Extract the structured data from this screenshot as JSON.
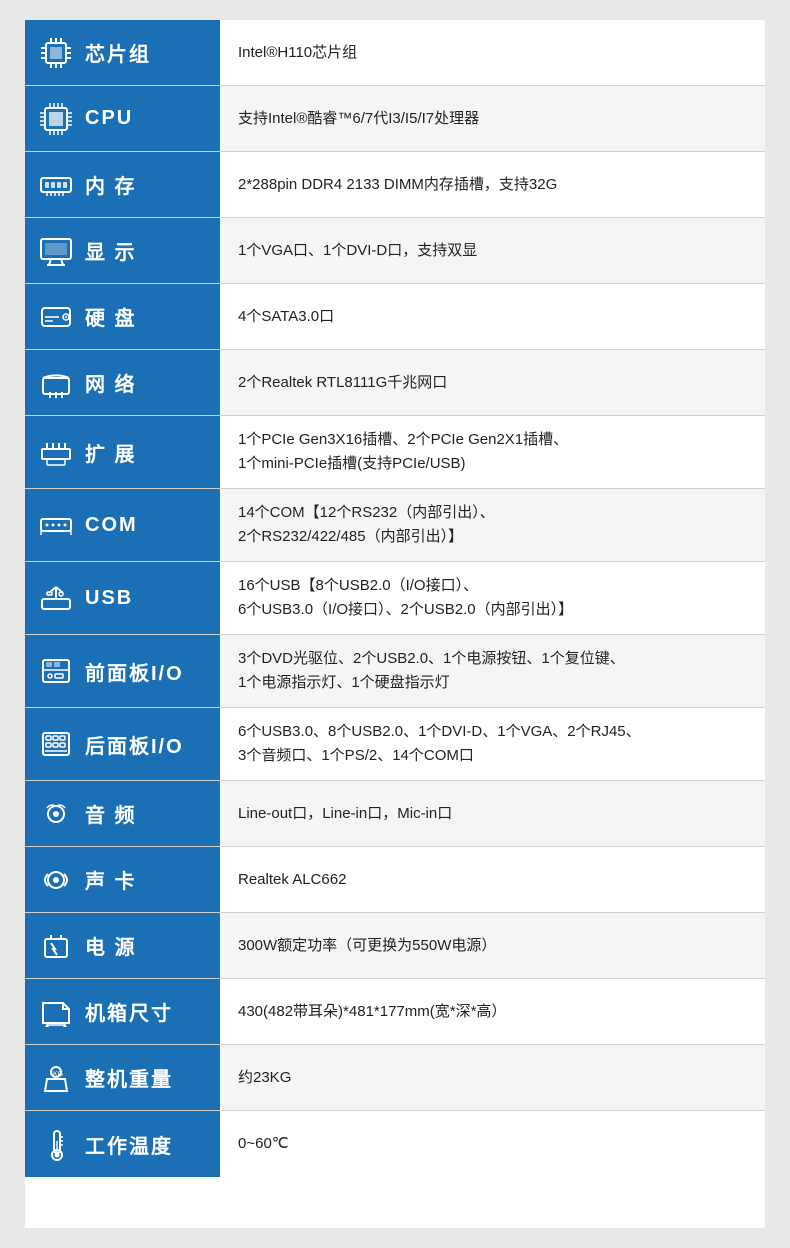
{
  "rows": [
    {
      "id": "chipset",
      "icon": "chipset",
      "label": "芯片组",
      "value": "Intel®H110芯片组"
    },
    {
      "id": "cpu",
      "icon": "cpu",
      "label": "CPU",
      "value": "支持Intel®酷睿™6/7代I3/I5/I7处理器"
    },
    {
      "id": "memory",
      "icon": "memory",
      "label": "内  存",
      "value": "2*288pin DDR4 2133 DIMM内存插槽，支持32G"
    },
    {
      "id": "display",
      "icon": "display",
      "label": "显  示",
      "value": "1个VGA口、1个DVI-D口，支持双显"
    },
    {
      "id": "hdd",
      "icon": "hdd",
      "label": "硬  盘",
      "value": "4个SATA3.0口"
    },
    {
      "id": "network",
      "icon": "network",
      "label": "网  络",
      "value": "2个Realtek RTL8111G千兆网口"
    },
    {
      "id": "expansion",
      "icon": "expansion",
      "label": "扩  展",
      "value": "1个PCIe Gen3X16插槽、2个PCIe Gen2X1插槽、\n1个mini-PCIe插槽(支持PCIe/USB)"
    },
    {
      "id": "com",
      "icon": "com",
      "label": "COM",
      "value": "14个COM【12个RS232（内部引出）、\n2个RS232/422/485（内部引出）】"
    },
    {
      "id": "usb",
      "icon": "usb",
      "label": "USB",
      "value": "16个USB【8个USB2.0（I/O接口）、\n6个USB3.0（I/O接口）、2个USB2.0（内部引出）】"
    },
    {
      "id": "front-io",
      "icon": "front-io",
      "label": "前面板I/O",
      "value": "3个DVD光驱位、2个USB2.0、1个电源按钮、1个复位键、\n1个电源指示灯、1个硬盘指示灯"
    },
    {
      "id": "rear-io",
      "icon": "rear-io",
      "label": "后面板I/O",
      "value": "6个USB3.0、8个USB2.0、1个DVI-D、1个VGA、2个RJ45、\n3个音频口、1个PS/2、14个COM口"
    },
    {
      "id": "audio",
      "icon": "audio",
      "label": "音  频",
      "value": "Line-out口，Line-in口，Mic-in口"
    },
    {
      "id": "sound-card",
      "icon": "sound-card",
      "label": "声  卡",
      "value": "Realtek ALC662"
    },
    {
      "id": "power",
      "icon": "power",
      "label": "电  源",
      "value": "300W额定功率（可更换为550W电源）"
    },
    {
      "id": "dimensions",
      "icon": "dimensions",
      "label": "机箱尺寸",
      "value": "430(482带耳朵)*481*177mm(宽*深*高）"
    },
    {
      "id": "weight",
      "icon": "weight",
      "label": "整机重量",
      "value": "约23KG"
    },
    {
      "id": "temperature",
      "icon": "temperature",
      "label": "工作温度",
      "value": "0~60℃"
    }
  ]
}
